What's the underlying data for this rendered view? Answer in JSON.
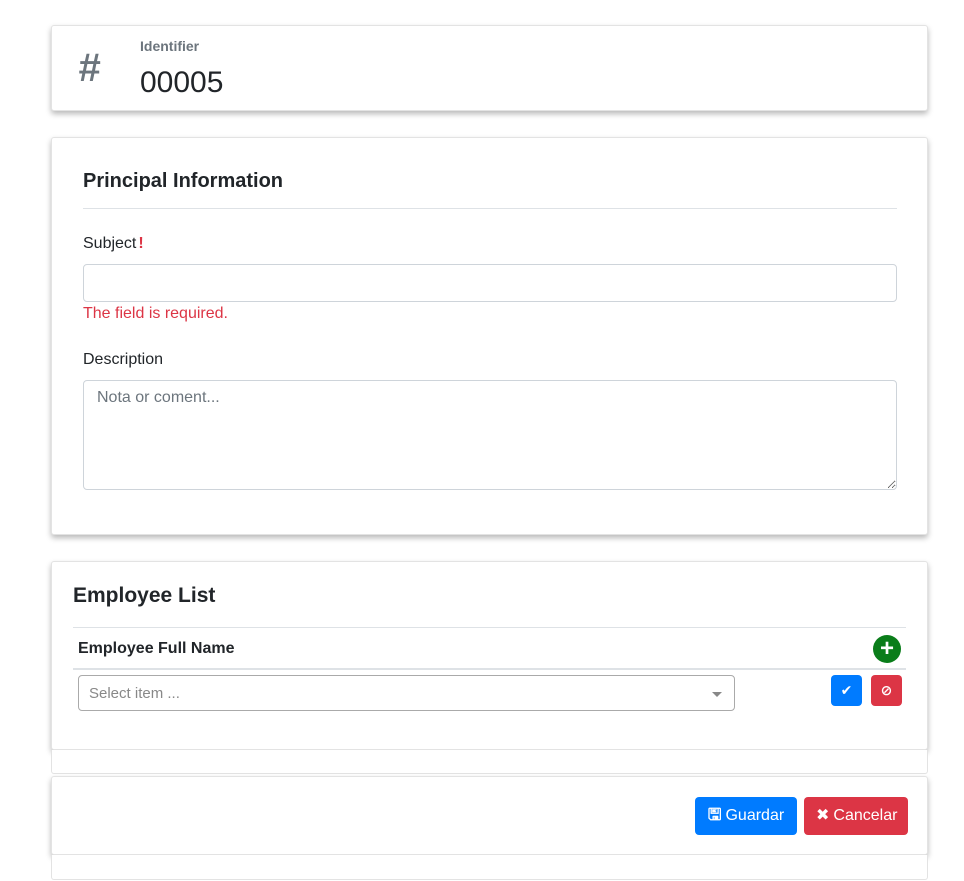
{
  "identifier": {
    "icon": "hash-icon",
    "label": "Identifier",
    "value": "00005"
  },
  "principal": {
    "title": "Principal Information",
    "subject_label": "Subject",
    "subject_required_mark": "!",
    "subject_value": "",
    "subject_error": "The field is required.",
    "description_label": "Description",
    "description_placeholder": "Nota or coment..."
  },
  "employees": {
    "title": "Employee List",
    "column_header": "Employee Full Name",
    "add_icon": "plus-circle-icon",
    "add_symbol": "+",
    "select_placeholder": "Select item ...",
    "confirm_icon": "check-icon",
    "confirm_symbol": "✔",
    "remove_icon": "ban-icon",
    "remove_symbol": "⊘"
  },
  "footer": {
    "save_icon": "save-icon",
    "save_symbol": "🖫",
    "save_label": "Guardar",
    "cancel_icon": "close-icon",
    "cancel_symbol": "✖",
    "cancel_label": "Cancelar"
  },
  "colors": {
    "primary": "#007bff",
    "danger": "#dc3545",
    "success": "#0a7d1a",
    "muted": "#6c757d"
  }
}
